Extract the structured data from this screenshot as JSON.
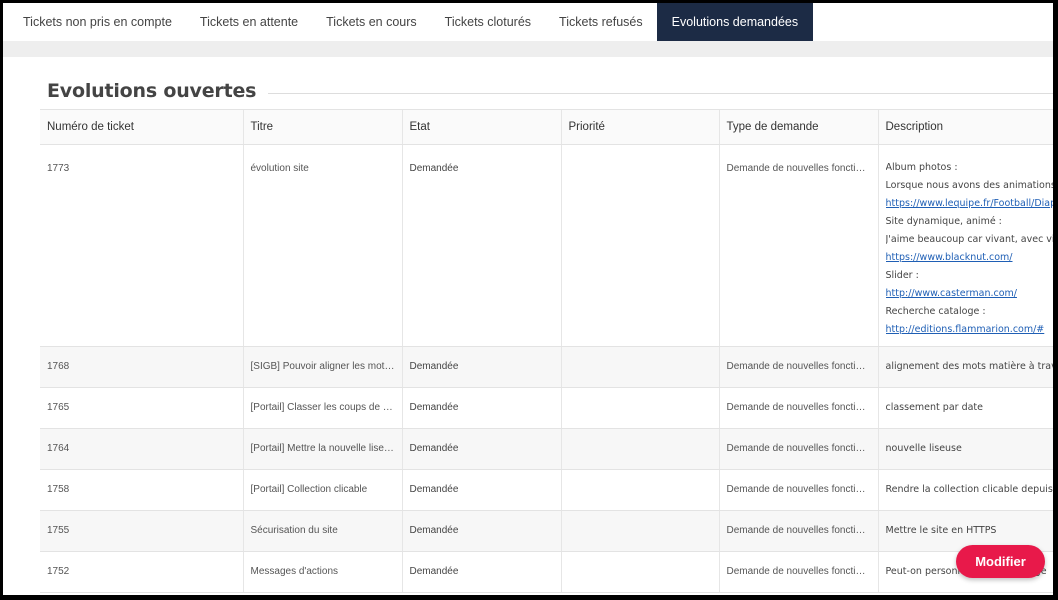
{
  "tabs": [
    {
      "label": "Tickets non pris en compte",
      "active": false
    },
    {
      "label": "Tickets en attente",
      "active": false
    },
    {
      "label": "Tickets en cours",
      "active": false
    },
    {
      "label": "Tickets cloturés",
      "active": false
    },
    {
      "label": "Tickets refusés",
      "active": false
    },
    {
      "label": "Evolutions demandées",
      "active": true
    }
  ],
  "section": {
    "title": "Evolutions ouvertes"
  },
  "table": {
    "headers": [
      "Numéro de ticket",
      "Titre",
      "Etat",
      "Priorité",
      "Type de demande",
      "Description"
    ],
    "rows": [
      {
        "numero": "1773",
        "titre": "évolution site",
        "etat": "Demandée",
        "priorite": "",
        "type": "Demande de nouvelles fonctionnalit…",
        "description_lines": [
          {
            "text": "Album photos :",
            "link": false
          },
          {
            "text": "Lorsque nous avons des animations, nous aimerions",
            "link": false
          },
          {
            "text": "https://www.lequipe.fr/Football/Diaporama",
            "link": true
          },
          {
            "text": "Site dynamique, animé :",
            "link": false
          },
          {
            "text": "J'aime beaucoup car vivant, avec vidéos",
            "link": false
          },
          {
            "text": "https://www.blacknut.com/",
            "link": true
          },
          {
            "text": "Slider :",
            "link": false
          },
          {
            "text": "http://www.casterman.com/",
            "link": true
          },
          {
            "text": "Recherche cataloge :",
            "link": false
          },
          {
            "text": "http://editions.flammarion.com/#",
            "link": true
          }
        ]
      },
      {
        "numero": "1768",
        "titre": "[SIGB] Pouvoir aligner les mots matiè…",
        "etat": "Demandée",
        "priorite": "",
        "type": "Demande de nouvelles fonctionnalit…",
        "description_lines": [
          {
            "text": "alignement des mots matière à travers",
            "link": false
          }
        ]
      },
      {
        "numero": "1765",
        "titre": "[Portail] Classer les coups de coeur p…",
        "etat": "Demandée",
        "priorite": "",
        "type": "Demande de nouvelles fonctionnalit…",
        "description_lines": [
          {
            "text": "classement par date",
            "link": false
          }
        ]
      },
      {
        "numero": "1764",
        "titre": "[Portail] Mettre la nouvelle liseuse",
        "etat": "Demandée",
        "priorite": "",
        "type": "Demande de nouvelles fonctionnalit…",
        "description_lines": [
          {
            "text": "nouvelle liseuse",
            "link": false
          }
        ]
      },
      {
        "numero": "1758",
        "titre": "[Portail] Collection clicable",
        "etat": "Demandée",
        "priorite": "",
        "type": "Demande de nouvelles fonctionnalit…",
        "description_lines": [
          {
            "text": "Rendre la collection clicable depuis la",
            "link": false
          }
        ]
      },
      {
        "numero": "1755",
        "titre": "Sécurisation du site",
        "etat": "Demandée",
        "priorite": "",
        "type": "Demande de nouvelles fonctionnalit…",
        "description_lines": [
          {
            "text": "Mettre le site en HTTPS",
            "link": false
          }
        ]
      },
      {
        "numero": "1752",
        "titre": "Messages d'actions",
        "etat": "Demandée",
        "priorite": "",
        "type": "Demande de nouvelles fonctionnalit…",
        "description_lines": [
          {
            "text": "Peut-on personnaliser le message",
            "link": false
          }
        ]
      }
    ]
  },
  "actions": {
    "modifier_label": "Modifier"
  },
  "colors": {
    "tab_active_bg": "#1c2b45",
    "button_bg": "#e8194a",
    "link": "#1f5fb5"
  }
}
